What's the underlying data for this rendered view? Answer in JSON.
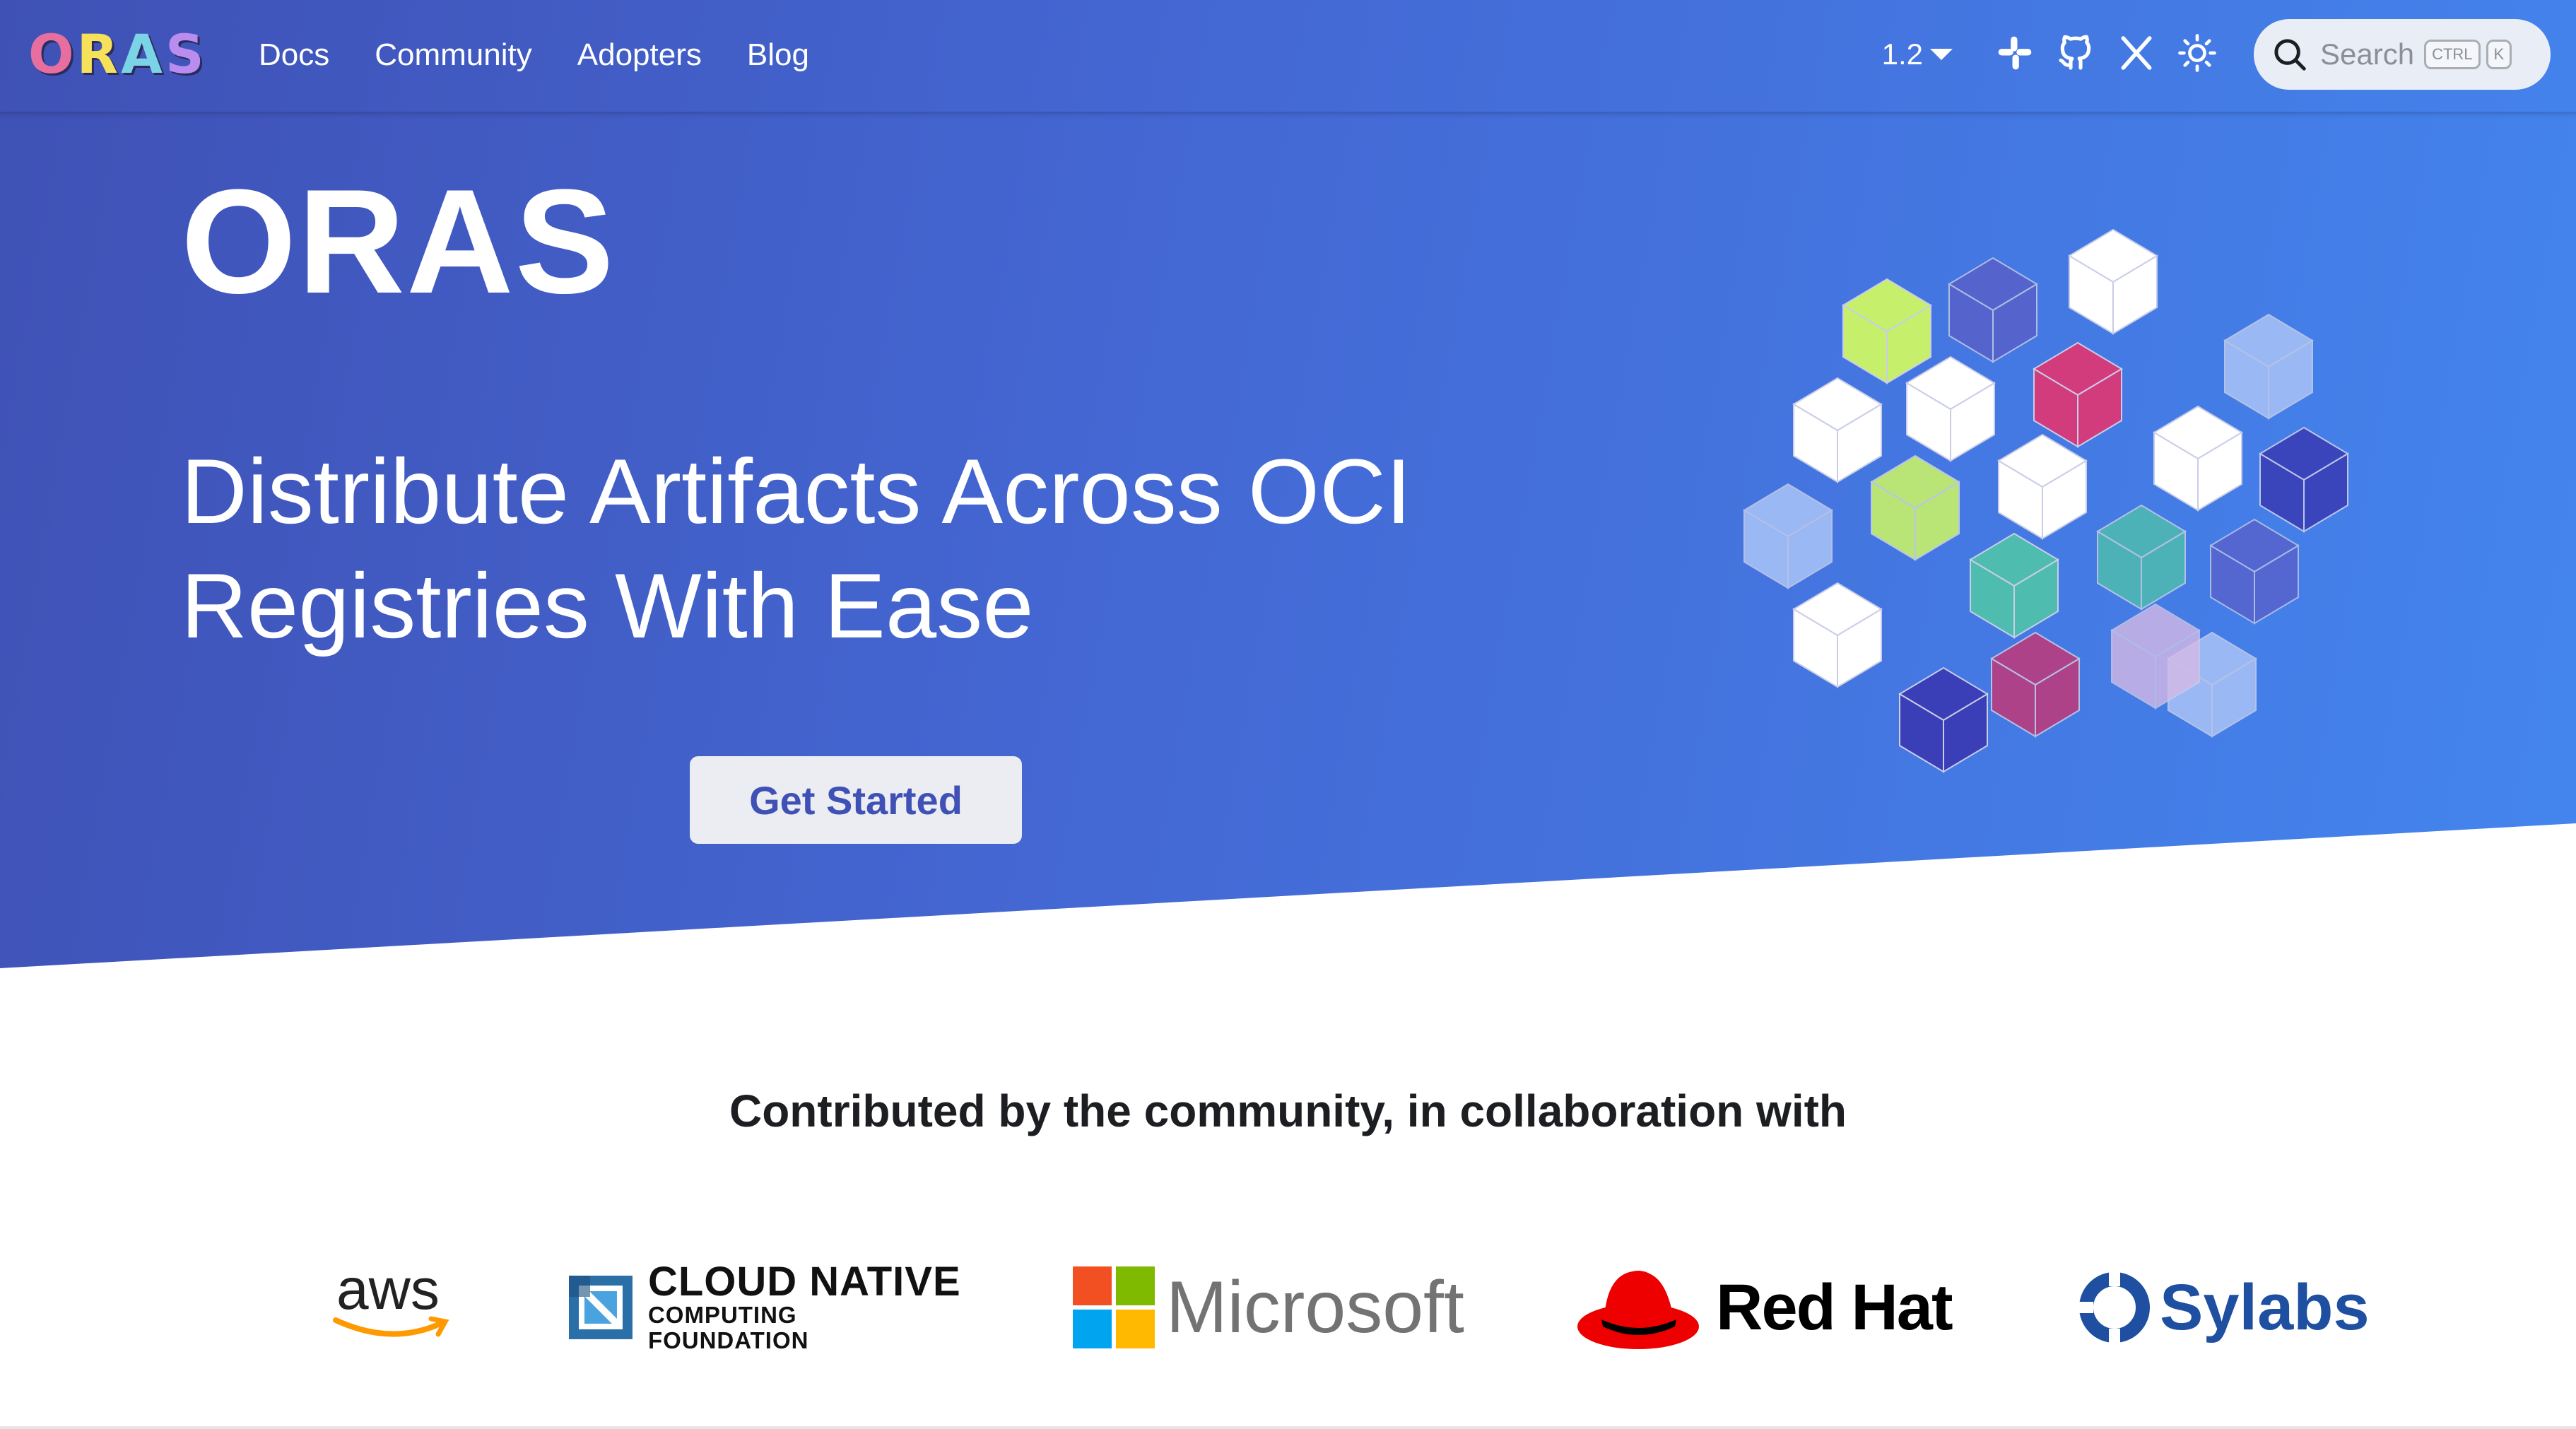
{
  "navbar": {
    "logo_letters": [
      "O",
      "R",
      "A",
      "S"
    ],
    "logo_colors": [
      "#e66fa0",
      "#f6e15b",
      "#7ad3e6",
      "#b98df0"
    ],
    "links": [
      {
        "label": "Docs"
      },
      {
        "label": "Community"
      },
      {
        "label": "Adopters"
      },
      {
        "label": "Blog"
      }
    ],
    "version": "1.2",
    "icons": [
      "slack-icon",
      "github-icon",
      "x-icon",
      "theme-toggle-icon"
    ],
    "search": {
      "placeholder": "Search",
      "shortcut_keys": [
        "CTRL",
        "K"
      ]
    }
  },
  "hero": {
    "title": "ORAS",
    "subtitle": "Distribute Artifacts Across OCI Registries With Ease",
    "cta_label": "Get Started",
    "gradient": [
      "#3f51b5",
      "#4485ee"
    ]
  },
  "collaboration": {
    "heading": "Contributed by the community, in collaboration with",
    "partners": [
      {
        "name": "aws",
        "text": "aws"
      },
      {
        "name": "cncf",
        "line1": "CLOUD NATIVE",
        "line2": "COMPUTING FOUNDATION"
      },
      {
        "name": "microsoft",
        "text": "Microsoft"
      },
      {
        "name": "redhat",
        "text": "Red Hat"
      },
      {
        "name": "sylabs",
        "text": "Sylabs"
      }
    ]
  },
  "colors": {
    "primary": "#3f51b5",
    "cube_green": "#c6f06b",
    "cube_pink": "#d23c7c",
    "cube_teal": "#4fbcb0",
    "cube_indigo": "#3a3fb8"
  }
}
